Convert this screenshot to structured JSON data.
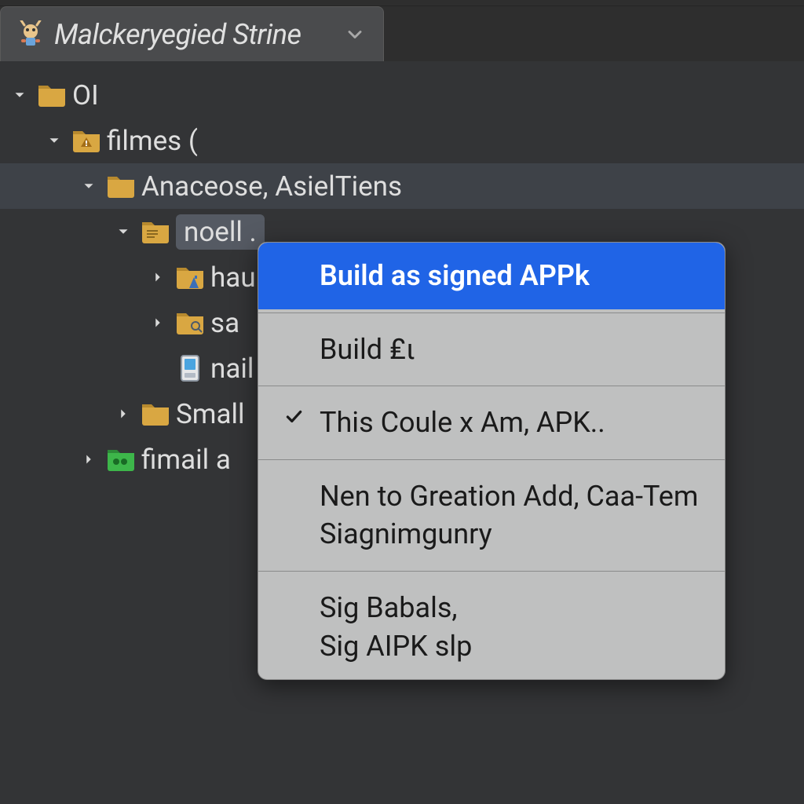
{
  "tab": {
    "title": "Malckeryegied Strine"
  },
  "tree": {
    "n0": "OI",
    "n1": "filmes (",
    "n2": "Anaceose, AsielTiens",
    "n3": "noell .",
    "n4": "hau",
    "n5": "sa",
    "n6": "nail",
    "n7": "Small",
    "n8": "fimail a"
  },
  "menu": {
    "m0": "Build as signed APPk",
    "m1": "Build ₤ι",
    "m2": "This Coule x Am, APK..",
    "m3": "Nen to Greation Add, Caa-Tem Siagnimgunry",
    "m4": "Sig Babals,\nSig AIPK slp"
  },
  "colors": {
    "accent": "#2064e6",
    "panel": "#333436",
    "selected": "#3e4248"
  }
}
